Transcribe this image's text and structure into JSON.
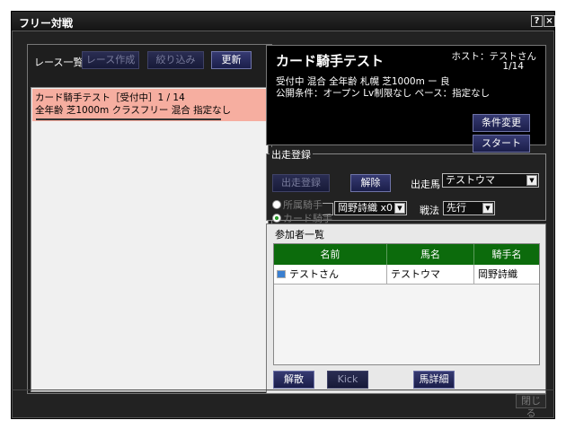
{
  "window": {
    "title": "フリー対戦",
    "help_label": "?",
    "close_x_label": "×",
    "close_label": "閉じる"
  },
  "race_list": {
    "label": "レース一覧",
    "create_label": "レース作成",
    "filter_label": "絞り込み",
    "refresh_label": "更新",
    "items": [
      {
        "line1": "カード騎手テスト［受付中］1 / 14",
        "line2": "全年齢  芝1000m  クラスフリー  混合  指定なし"
      }
    ]
  },
  "race_info": {
    "title": "カード騎手テスト",
    "host": "ホスト：テストさん",
    "count": "1/14",
    "line1": "受付中  混合  全年齢  札幌  芝1000m  ー  良",
    "line2": "公開条件：オープン  Lv制限なし  ペース：指定なし",
    "change_conditions_label": "条件変更",
    "start_label": "スタート"
  },
  "entry": {
    "section_label": "出走登録",
    "register_label": "出走登録",
    "cancel_label": "解除",
    "horse_label": "出走馬",
    "horse_value": "テストウマ",
    "own_jockey_label": "所属騎手",
    "card_jockey_label": "カード騎手",
    "jockey_value": "岡野詩織 x0",
    "tactic_label": "戦法",
    "tactic_value": "先行"
  },
  "participants": {
    "label": "参加者一覧",
    "columns": [
      "名前",
      "馬名",
      "騎手名"
    ],
    "rows": [
      {
        "name": "テストさん",
        "horse": "テストウマ",
        "jockey": "岡野詩織"
      }
    ],
    "disband_label": "解散",
    "kick_label": "Kick",
    "horse_detail_label": "馬詳細"
  }
}
